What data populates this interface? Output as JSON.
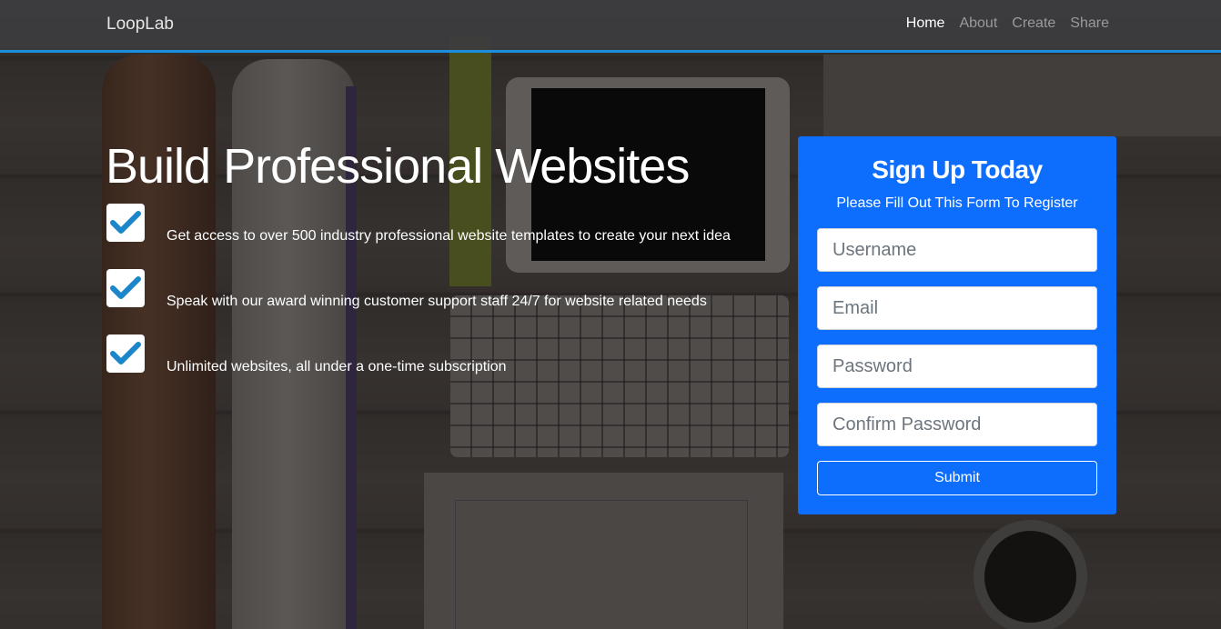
{
  "navbar": {
    "brand": "LoopLab",
    "links": [
      {
        "label": "Home",
        "active": true
      },
      {
        "label": "About",
        "active": false
      },
      {
        "label": "Create",
        "active": false
      },
      {
        "label": "Share",
        "active": false
      }
    ]
  },
  "hero": {
    "title": "Build Professional Websites",
    "features": [
      {
        "icon": "checkmark-icon",
        "text": "Get access to over 500 industry professional website templates to create your next idea"
      },
      {
        "icon": "checkmark-icon",
        "text": "Speak with our award winning customer support staff 24/7 for website related needs"
      },
      {
        "icon": "checkmark-icon",
        "text": "Unlimited websites, all under a one-time subscription"
      }
    ]
  },
  "signup": {
    "title": "Sign Up Today",
    "subtitle": "Please Fill Out This Form To Register",
    "fields": {
      "username": {
        "placeholder": "Username",
        "value": ""
      },
      "email": {
        "placeholder": "Email",
        "value": ""
      },
      "password": {
        "placeholder": "Password",
        "value": ""
      },
      "confirm_password": {
        "placeholder": "Confirm Password",
        "value": ""
      }
    },
    "submit_label": "Submit"
  },
  "colors": {
    "accent": "#0d6efd",
    "nav_border": "#1a8fe0",
    "check": "#1b86c9"
  }
}
